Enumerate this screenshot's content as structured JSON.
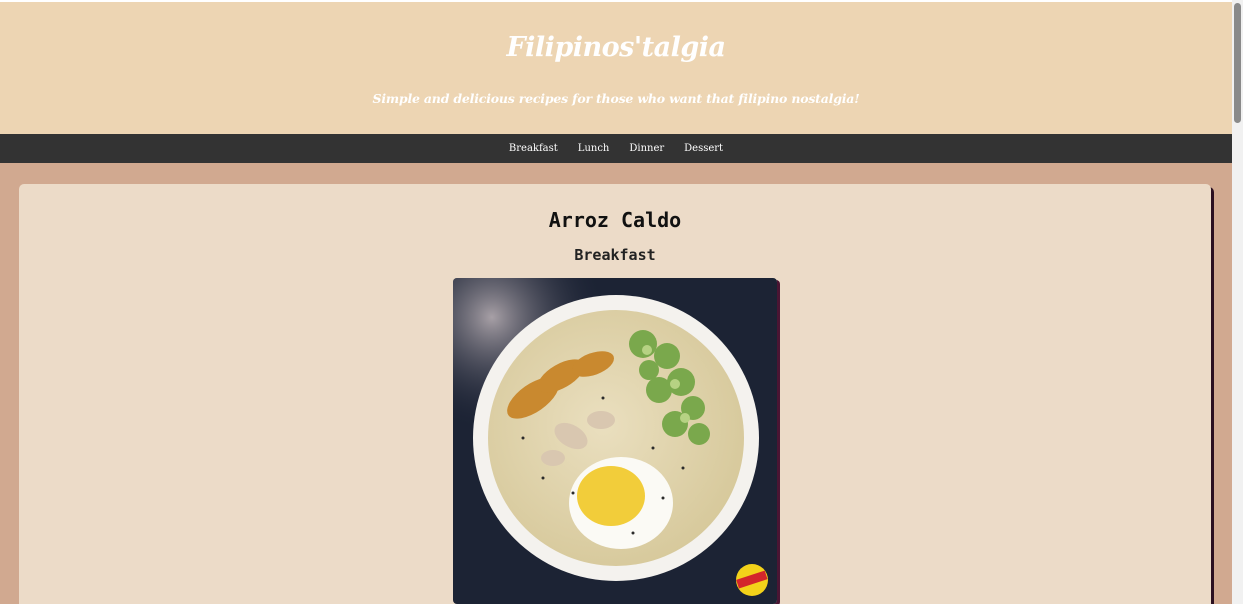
{
  "header": {
    "title": "Filipinos'talgia",
    "tagline": "Simple and delicious recipes for those who want that filipino nostalgia!"
  },
  "nav": {
    "items": [
      {
        "label": "Breakfast"
      },
      {
        "label": "Lunch"
      },
      {
        "label": "Dinner"
      },
      {
        "label": "Dessert"
      }
    ]
  },
  "recipe": {
    "title": "Arroz Caldo",
    "category": "Breakfast",
    "image_alt": "Arroz Caldo"
  },
  "colors": {
    "header_bg": "#edd5b3",
    "nav_bg": "#333333",
    "page_bg": "#d1a990",
    "card_bg": "#ecdbc8"
  }
}
